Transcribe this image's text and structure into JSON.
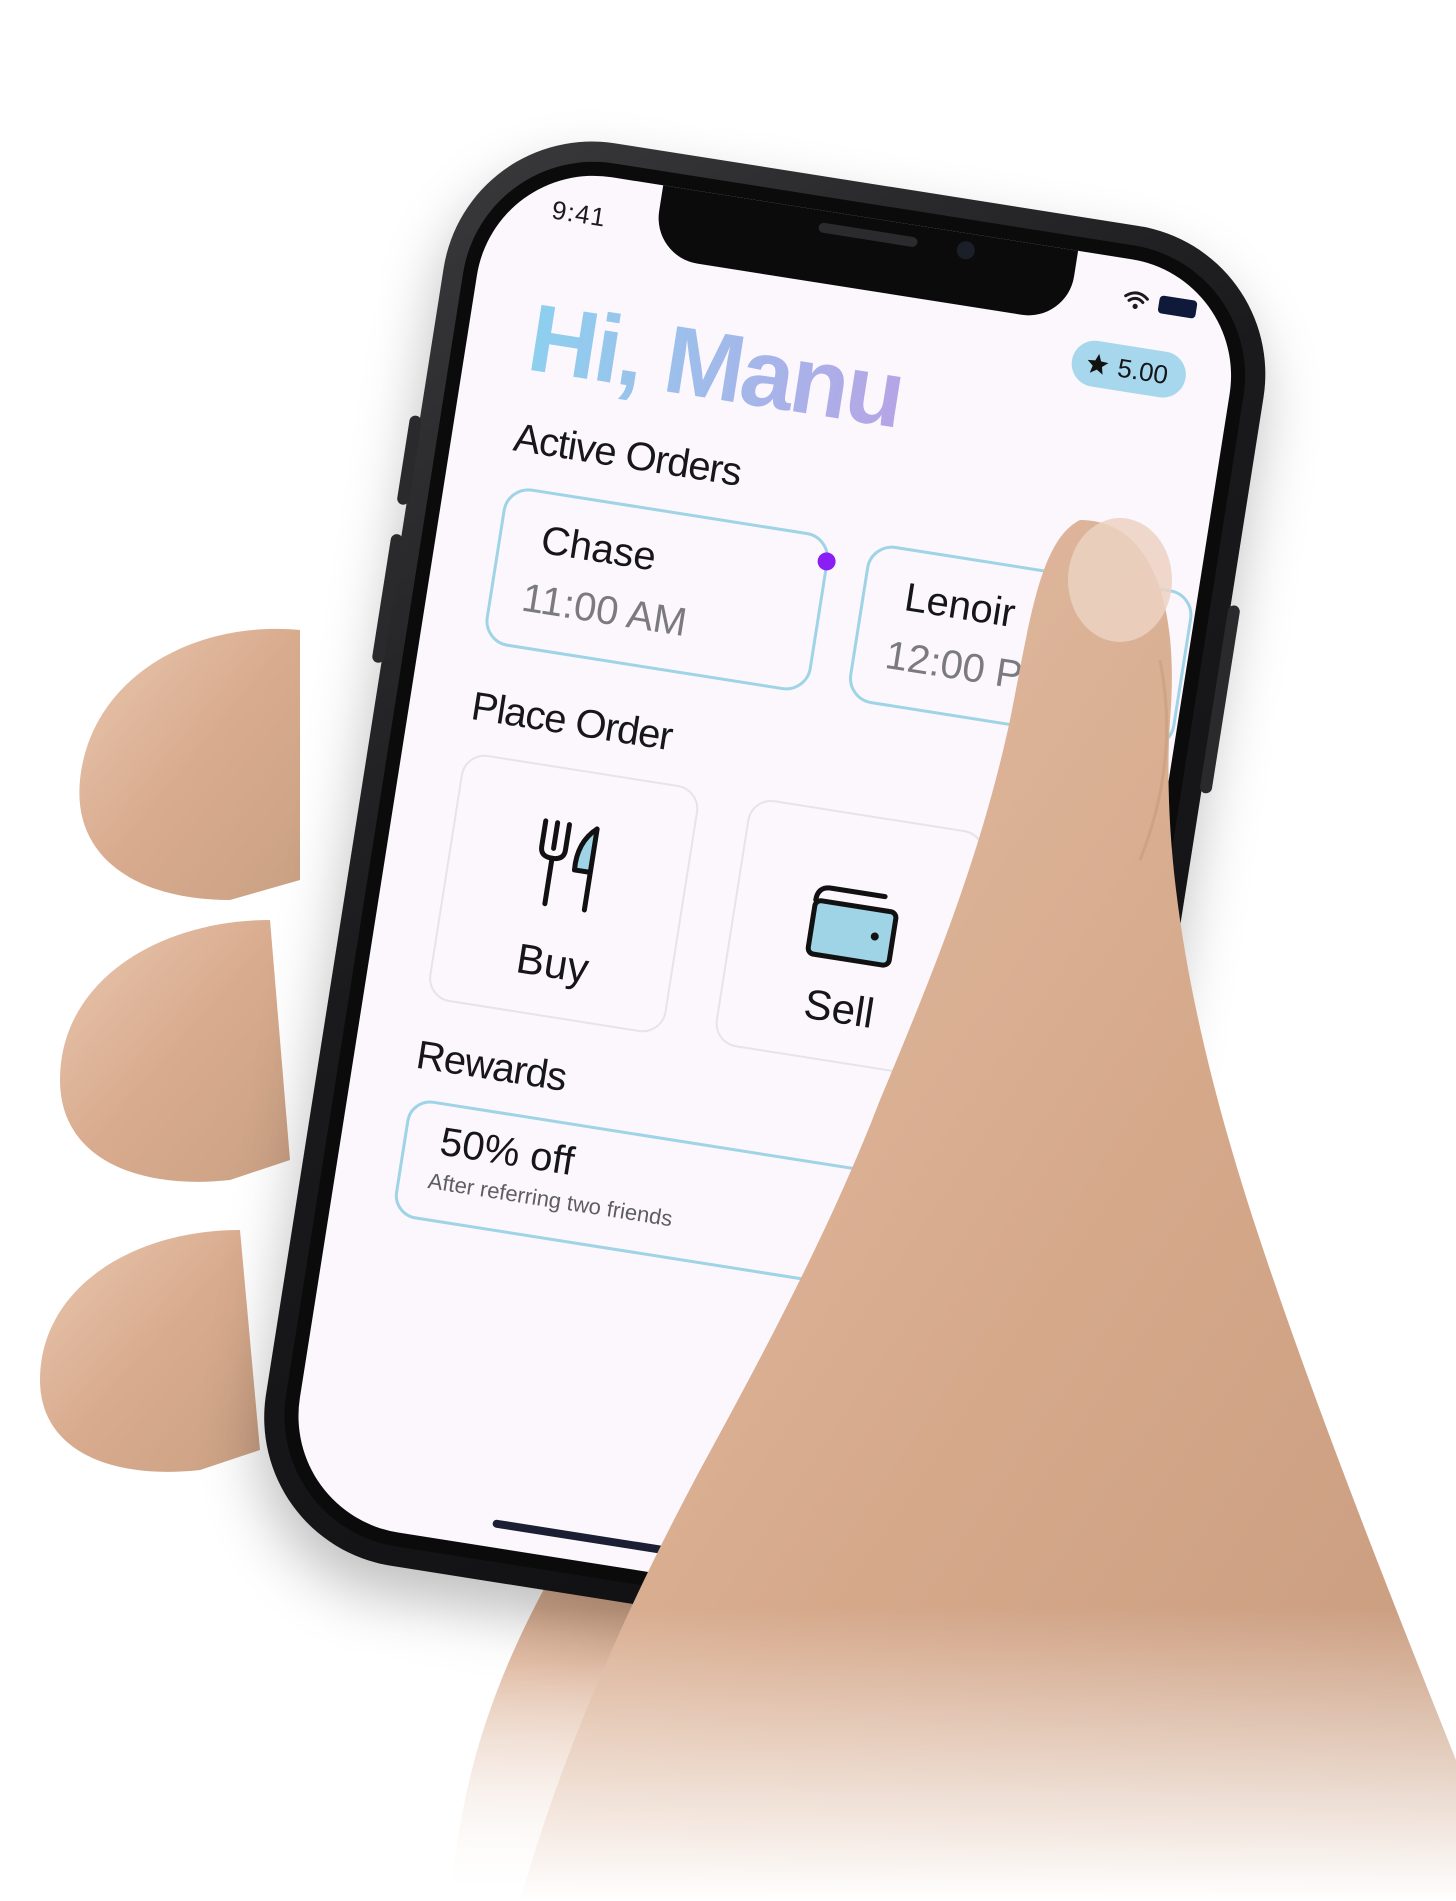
{
  "status_bar": {
    "time": "9:41"
  },
  "rating": {
    "icon": "star-icon",
    "value": "5.00",
    "pill_color": "#a7d7ec"
  },
  "greeting": "Hi, Manu",
  "active_orders": {
    "title": "Active Orders",
    "orders": [
      {
        "name": "Chase",
        "time": "11:00 AM",
        "has_dot": true
      },
      {
        "name": "Lenoir",
        "time": "12:00 PM",
        "has_dot": false
      }
    ],
    "dot_color": "#8a1ef5",
    "border_color": "#9fd3e6"
  },
  "place_order": {
    "title": "Place Order",
    "actions": [
      {
        "label": "Buy",
        "icon": "fork-knife-icon"
      },
      {
        "label": "Sell",
        "icon": "wallet-icon"
      }
    ]
  },
  "rewards": {
    "title": "Rewards",
    "items": [
      {
        "title": "50% off",
        "subtitle": "After referring two friends"
      }
    ]
  },
  "colors": {
    "screen_bg": "#fbf7fc",
    "greeting_gradient_start": "#8dd0ee",
    "greeting_gradient_end": "#b5a5e6",
    "wallet_fill": "#9fd3e6"
  }
}
